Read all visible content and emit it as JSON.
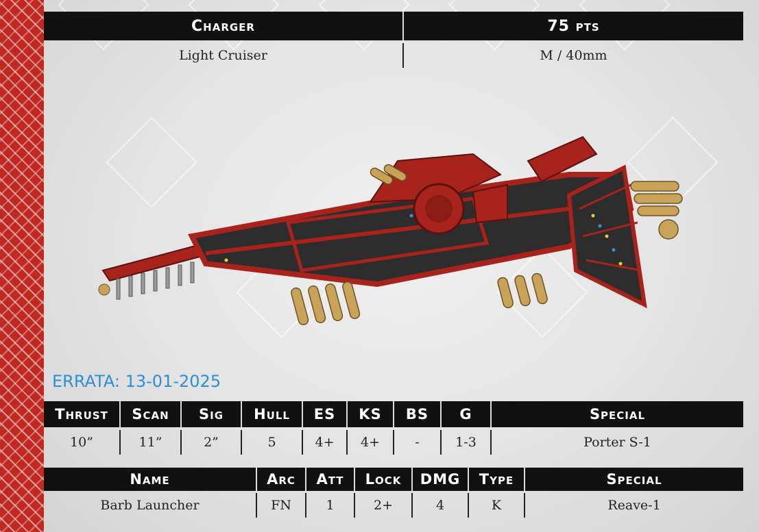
{
  "unit": {
    "name": "Charger",
    "points": "75 pts",
    "class": "Light Cruiser",
    "size": "M / 40mm"
  },
  "errata": "ERRATA: 13-01-2025",
  "stats": {
    "headers": [
      "Thrust",
      "Scan",
      "Sig",
      "Hull",
      "ES",
      "KS",
      "BS",
      "G",
      "Special"
    ],
    "values": [
      "10”",
      "11”",
      "2”",
      "5",
      "4+",
      "4+",
      "-",
      "1-3",
      "Porter S-1"
    ]
  },
  "weapons": {
    "headers": [
      "Name",
      "Arc",
      "Att",
      "Lock",
      "DMG",
      "Type",
      "Special"
    ],
    "rows": [
      [
        "Barb Launcher",
        "FN",
        "1",
        "2+",
        "4",
        "K",
        "Reave-1"
      ]
    ]
  },
  "colors": {
    "accent_red": "#c1281f",
    "header_black": "#111111",
    "errata_blue": "#2b8fd8",
    "ship_red": "#a8231c",
    "ship_dark": "#2d2d2d",
    "ship_gold": "#c9a25a"
  }
}
